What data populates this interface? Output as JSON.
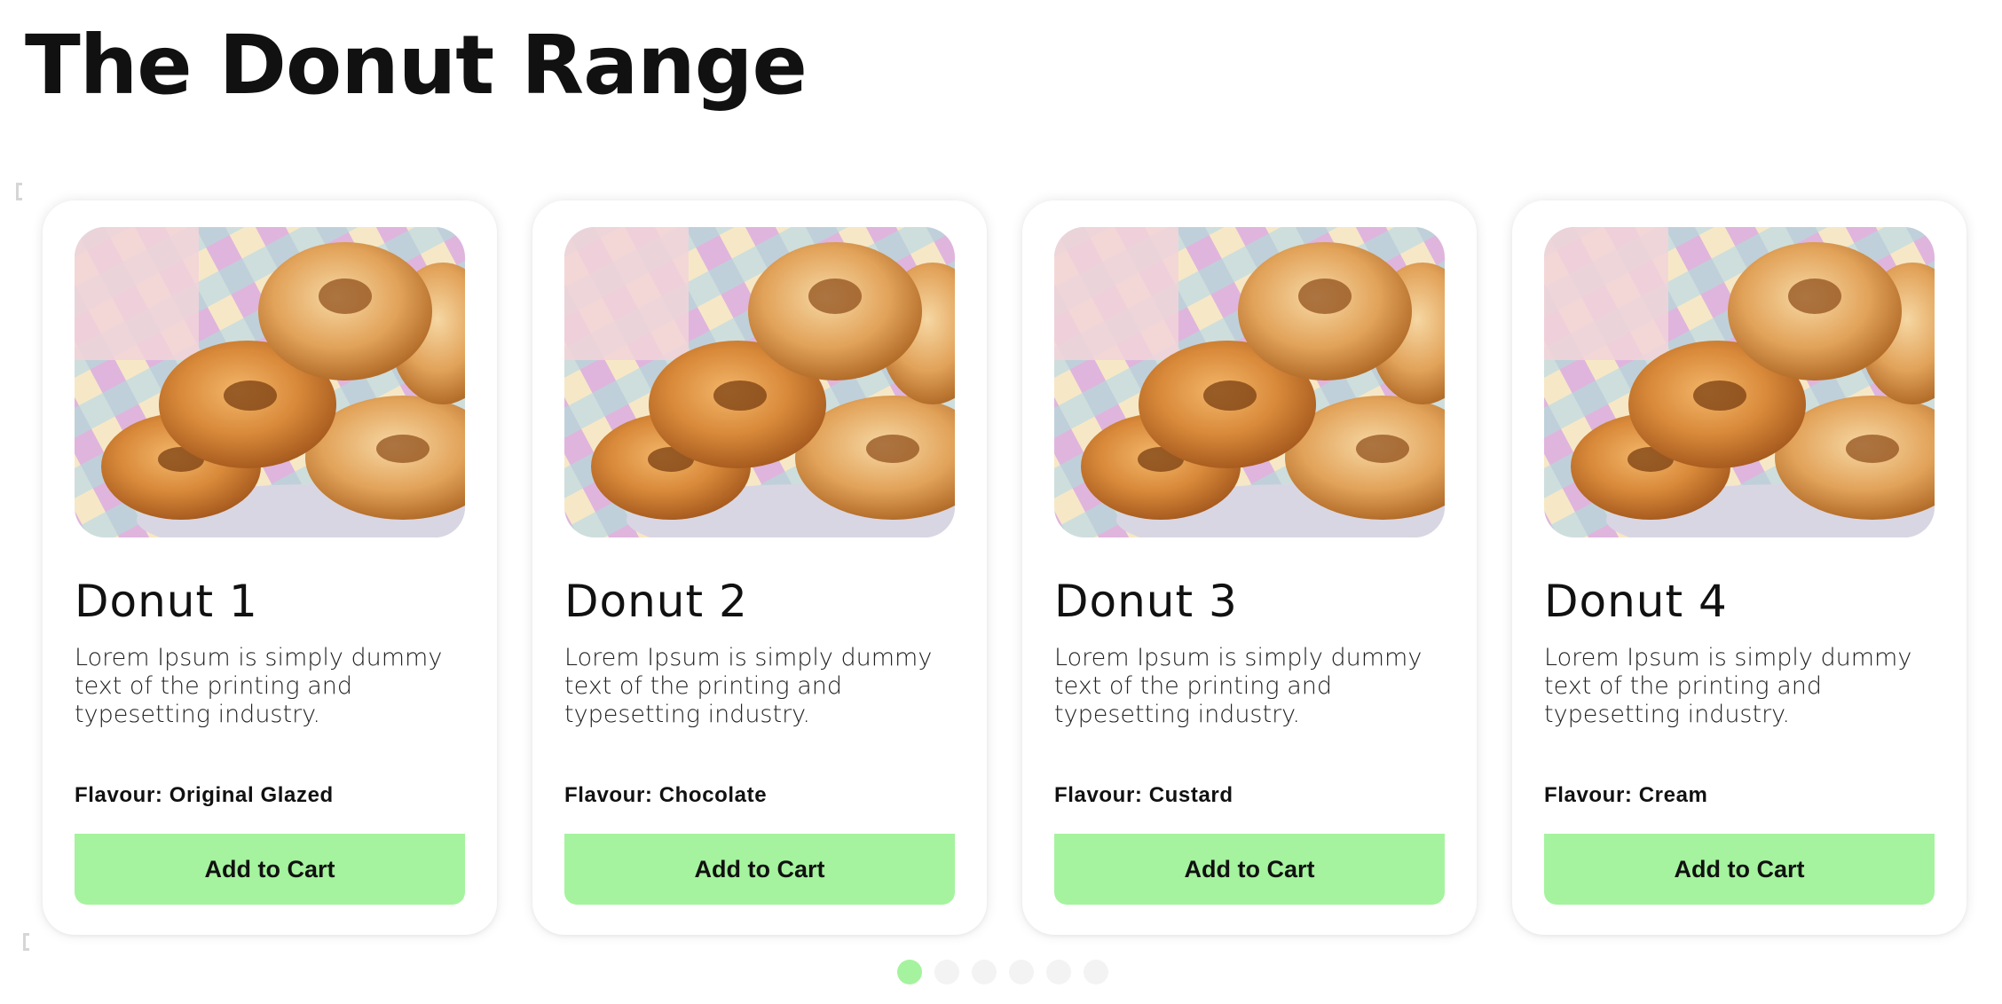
{
  "page": {
    "title": "The Donut Range"
  },
  "colors": {
    "button_bg": "#a5f39e",
    "active_dot": "#a5f39e",
    "inactive_dot": "#f3f3f3"
  },
  "cards": [
    {
      "title": "Donut 1",
      "description": "Lorem Ipsum is simply dummy text of the printing and typesetting industry.",
      "flavour": "Flavour: Original Glazed",
      "button_label": "Add to Cart",
      "image_icon": "donut-photo"
    },
    {
      "title": "Donut 2",
      "description": "Lorem Ipsum is simply dummy text of the printing and typesetting industry.",
      "flavour": "Flavour: Chocolate",
      "button_label": "Add to Cart",
      "image_icon": "donut-photo"
    },
    {
      "title": "Donut 3",
      "description": "Lorem Ipsum is simply dummy text of the printing and typesetting industry.",
      "flavour": "Flavour: Custard",
      "button_label": "Add to Cart",
      "image_icon": "donut-photo"
    },
    {
      "title": "Donut 4",
      "description": "Lorem Ipsum is simply dummy text of the printing and typesetting industry.",
      "flavour": "Flavour: Cream",
      "button_label": "Add to Cart",
      "image_icon": "donut-photo"
    }
  ],
  "pagination": {
    "total_pages": 6,
    "active_index": 0
  }
}
